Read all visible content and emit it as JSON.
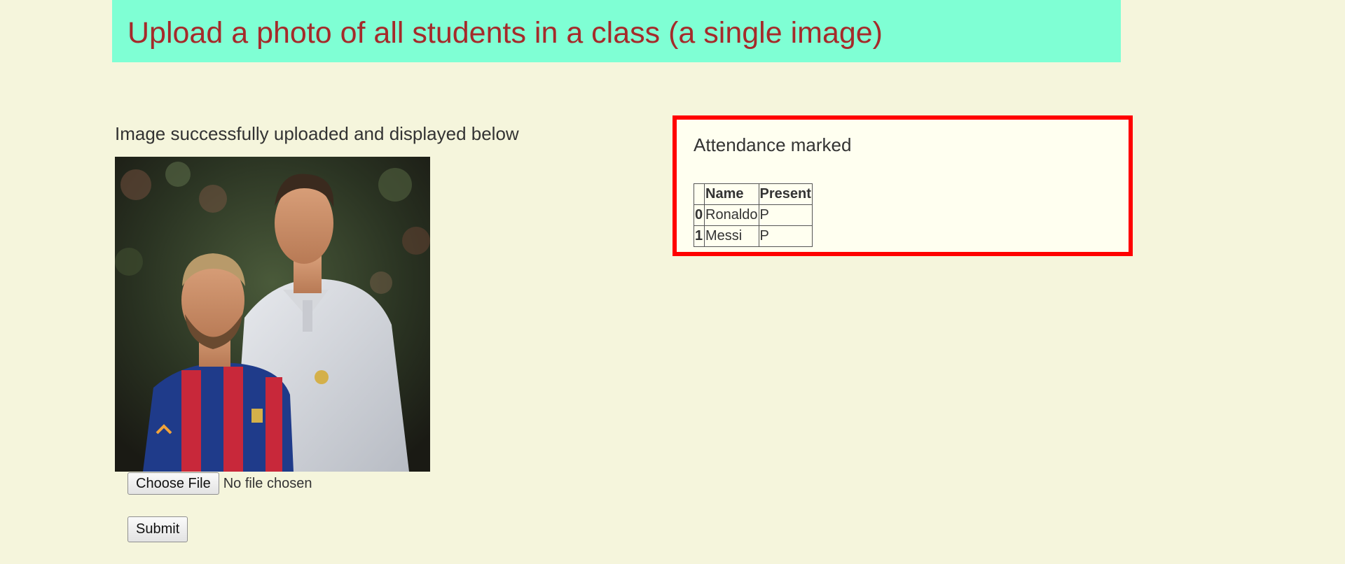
{
  "header": {
    "title": "Upload a photo of all students in a class (a single image)"
  },
  "upload": {
    "status_message": "Image successfully uploaded and displayed below",
    "choose_file_label": "Choose File",
    "file_status": "No file chosen",
    "submit_label": "Submit"
  },
  "attendance": {
    "title": "Attendance marked",
    "columns": [
      "",
      "Name",
      "Present"
    ],
    "rows": [
      {
        "index": "0",
        "name": "Ronaldo",
        "present": "P"
      },
      {
        "index": "1",
        "name": "Messi",
        "present": "P"
      }
    ]
  },
  "colors": {
    "page_background": "#f5f5dc",
    "header_background": "#7fffd4",
    "header_text": "#a52a2a",
    "panel_border": "#ff0000",
    "panel_background": "#fffff0"
  }
}
